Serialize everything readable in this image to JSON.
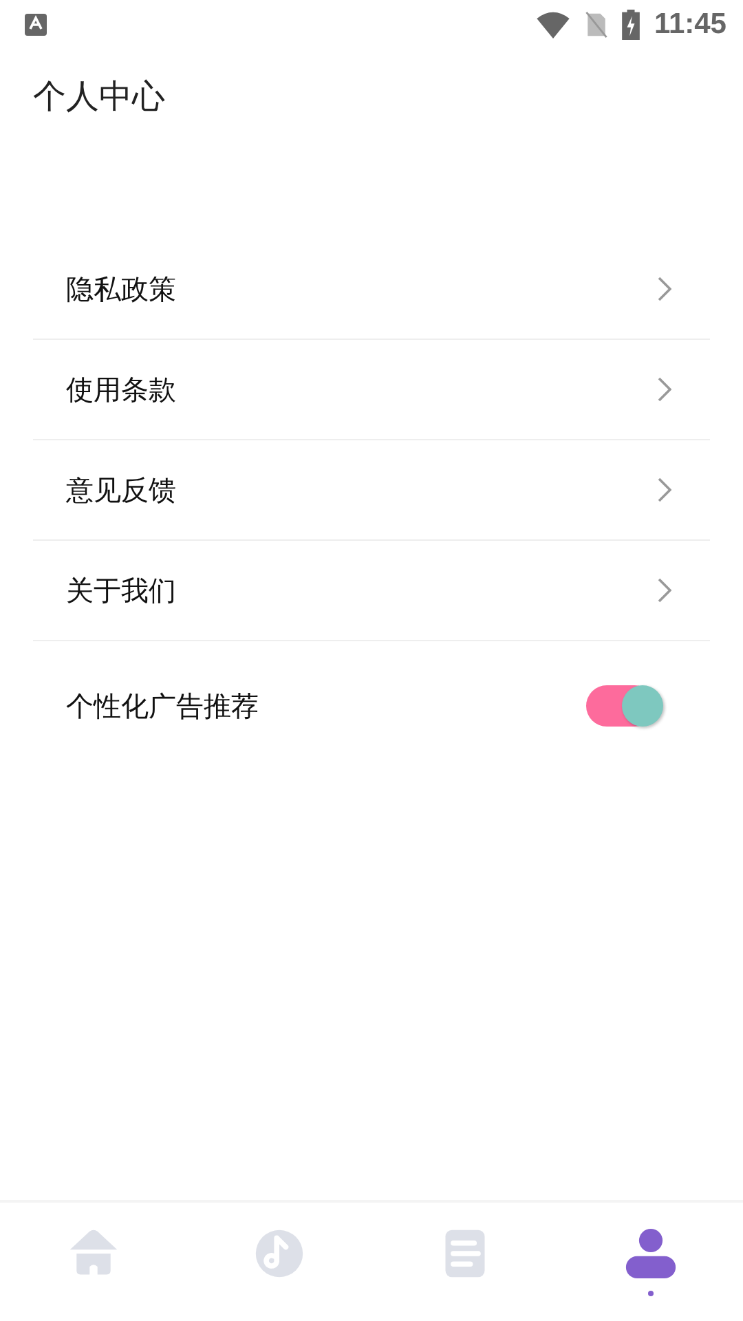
{
  "status_bar": {
    "time": "11:45"
  },
  "header": {
    "title": "个人中心"
  },
  "menu": [
    {
      "kind": "link",
      "label": "隐私政策"
    },
    {
      "kind": "link",
      "label": "使用条款"
    },
    {
      "kind": "link",
      "label": "意见反馈"
    },
    {
      "kind": "link",
      "label": "关于我们"
    },
    {
      "kind": "toggle",
      "label": "个性化广告推荐",
      "on": true
    }
  ],
  "tabs": [
    {
      "selected": false
    },
    {
      "selected": false
    },
    {
      "selected": false
    },
    {
      "selected": true
    }
  ]
}
